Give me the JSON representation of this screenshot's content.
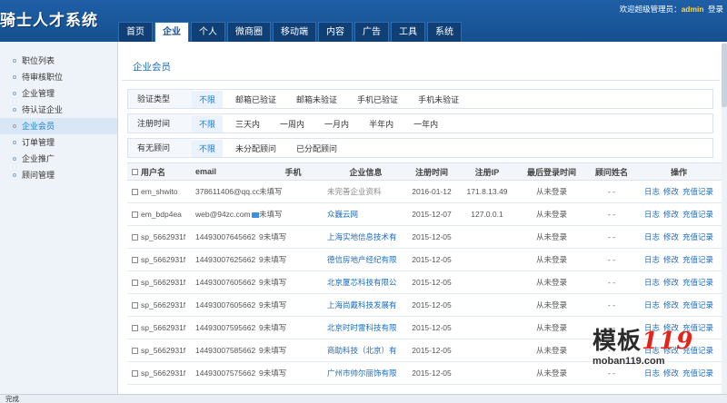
{
  "app": {
    "logo": "骑士人才系统",
    "welcome_prefix": "欢迎超级管理员：",
    "admin_name": "admin",
    "login_link": "登录"
  },
  "nav": {
    "tabs": [
      {
        "label": "首页",
        "active": false
      },
      {
        "label": "企业",
        "active": true
      },
      {
        "label": "个人",
        "active": false
      },
      {
        "label": "微商圈",
        "active": false
      },
      {
        "label": "移动端",
        "active": false
      },
      {
        "label": "内容",
        "active": false
      },
      {
        "label": "广告",
        "active": false
      },
      {
        "label": "工具",
        "active": false
      },
      {
        "label": "系统",
        "active": false
      }
    ]
  },
  "sidebar": {
    "items": [
      {
        "label": "职位列表",
        "active": false
      },
      {
        "label": "待审核职位",
        "active": false
      },
      {
        "label": "企业管理",
        "active": false
      },
      {
        "label": "待认证企业",
        "active": false
      },
      {
        "label": "企业会员",
        "active": true
      },
      {
        "label": "订单管理",
        "active": false
      },
      {
        "label": "企业推广",
        "active": false
      },
      {
        "label": "顾问管理",
        "active": false
      }
    ]
  },
  "main": {
    "title": "企业会员",
    "filters": [
      {
        "label": "验证类型",
        "options": [
          "不限",
          "邮箱已验证",
          "邮箱未验证",
          "手机已验证",
          "手机未验证"
        ],
        "selected": "不限"
      },
      {
        "label": "注册时间",
        "options": [
          "不限",
          "三天内",
          "一周内",
          "一月内",
          "半年内",
          "一年内"
        ],
        "selected": "不限"
      },
      {
        "label": "有无顾问",
        "options": [
          "不限",
          "未分配顾问",
          "已分配顾问"
        ],
        "selected": "不限"
      }
    ],
    "table": {
      "headers": {
        "user": "用户名",
        "email": "email",
        "phone": "手机",
        "company": "企业信息",
        "regdate": "注册时间",
        "regip": "注册IP",
        "lastlogin": "最后登录时间",
        "salesman": "顾问姓名",
        "ops": "操作"
      },
      "rows": [
        {
          "user": "em_shwito",
          "email": "378611406@qq.co",
          "phone": "未填写",
          "company": "未完善企业资料",
          "company_muted": true,
          "regdate": "2016-01-12",
          "regip": "171.8.13.49",
          "lastlogin": "从未登录",
          "salesman": "- -"
        },
        {
          "user": "em_bdp4ea",
          "email": "web@94zc.com",
          "email_icon": "mail-icon",
          "phone": "未填写",
          "company": "众巍云网",
          "company_muted": false,
          "regdate": "2015-12-07",
          "regip": "127.0.0.1",
          "lastlogin": "从未登录",
          "salesman": "- -"
        },
        {
          "user": "sp_5662931f",
          "email": "14493007645662",
          "phone": "9未填写",
          "company": "上海实地信息技术有",
          "company_muted": false,
          "regdate": "2015-12-05",
          "regip": "",
          "lastlogin": "从未登录",
          "salesman": "- -"
        },
        {
          "user": "sp_5662931f",
          "email": "14493007625662",
          "phone": "9未填写",
          "company": "德信房地产经纪有限",
          "company_muted": false,
          "regdate": "2015-12-05",
          "regip": "",
          "lastlogin": "从未登录",
          "salesman": "- -"
        },
        {
          "user": "sp_5662931f",
          "email": "14493007605662",
          "phone": "9未填写",
          "company": "北京厦芯科技有限公",
          "company_muted": false,
          "regdate": "2015-12-05",
          "regip": "",
          "lastlogin": "从未登录",
          "salesman": "- -"
        },
        {
          "user": "sp_5662931f",
          "email": "14493007605662",
          "phone": "9未填写",
          "company": "上海尚戴科技发展有",
          "company_muted": false,
          "regdate": "2015-12-05",
          "regip": "",
          "lastlogin": "从未登录",
          "salesman": "- -"
        },
        {
          "user": "sp_5662931f",
          "email": "14493007595662",
          "phone": "9未填写",
          "company": "北京时时雷科技有限",
          "company_muted": false,
          "regdate": "2015-12-05",
          "regip": "",
          "lastlogin": "从未登录",
          "salesman": "- -"
        },
        {
          "user": "sp_5662931f",
          "email": "14493007585662",
          "phone": "9未填写",
          "company": "商助科技（北京）有",
          "company_muted": false,
          "regdate": "2015-12-05",
          "regip": "",
          "lastlogin": "从未登录",
          "salesman": "- -"
        },
        {
          "user": "sp_5662931f",
          "email": "14493007575662",
          "phone": "9未填写",
          "company": "广州市帅尔丽饰有限",
          "company_muted": false,
          "regdate": "2015-12-05",
          "regip": "",
          "lastlogin": "从未登录",
          "salesman": "- -"
        }
      ],
      "ops": [
        "日志",
        "修改",
        "充值记录"
      ]
    }
  },
  "statusbar": {
    "text": "完成"
  },
  "watermark": {
    "main_text": "模板",
    "number": "119",
    "site": "moban119.com"
  }
}
